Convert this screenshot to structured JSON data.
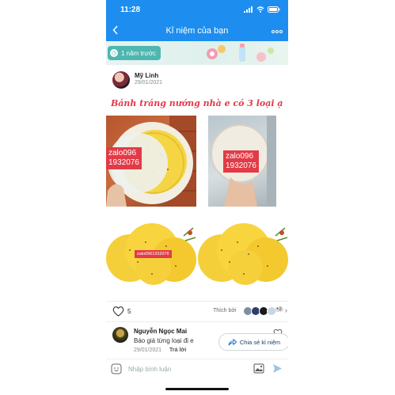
{
  "status_bar": {
    "time": "11:28"
  },
  "nav": {
    "title": "Kỉ niệm của bạn"
  },
  "banner": {
    "label": "1 năm trước"
  },
  "post": {
    "author": "Mỹ Linh",
    "date": "29/01/2021",
    "caption": "Bánh tráng nướng nhà e có 3 loại ạ",
    "photos": [
      {
        "watermark": "zalo096\n1932076"
      },
      {
        "watermark": "zalo096\n1932076"
      },
      {
        "watermark": "zalo0961932076"
      },
      {
        "watermark": ""
      }
    ]
  },
  "reactions": {
    "like_count": "5",
    "liked_by_label": "Thích bởi",
    "more_count": "+2"
  },
  "comment": {
    "author": "Nguyễn Ngọc Mai",
    "text": "Báo giá từng loại đi e",
    "date": "29/01/2021",
    "reply_label": "Trả lời"
  },
  "share_button": {
    "label": "Chia sẻ kỉ niệm"
  },
  "input": {
    "placeholder": "Nhập bình luận"
  },
  "colors": {
    "header_blue": "#1d8ef0",
    "caption_red": "#e5384a",
    "pill_teal": "#4db7b0",
    "watermark_red": "#e23b47"
  }
}
